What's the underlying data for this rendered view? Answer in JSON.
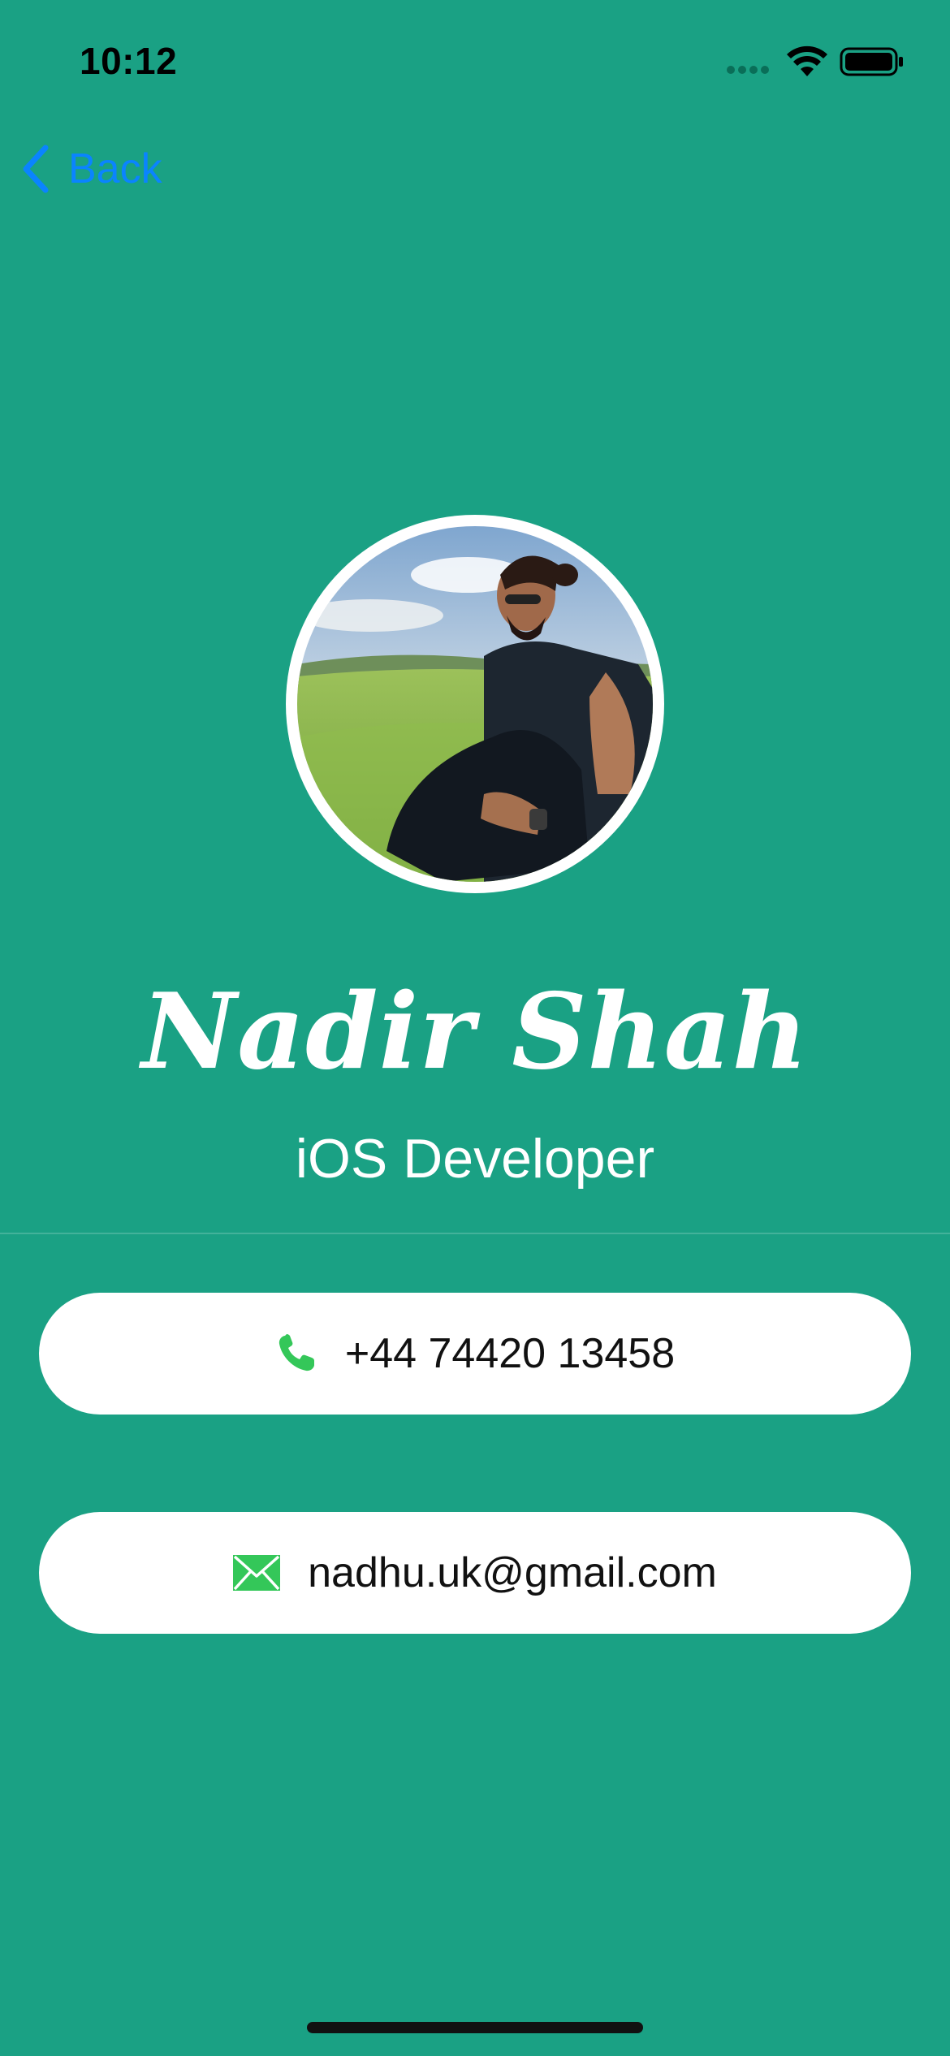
{
  "status_bar": {
    "time": "10:12",
    "icons": [
      "signal-icon",
      "wifi-icon",
      "battery-icon"
    ]
  },
  "nav": {
    "back_label": "Back",
    "back_icon": "chevron-left-icon"
  },
  "profile": {
    "name": "Nadir Shah",
    "title": "iOS Developer",
    "avatar_icon": "profile-photo"
  },
  "contacts": {
    "phone": "+44 74420 13458",
    "phone_icon": "phone-icon",
    "email": "nadhu.uk@gmail.com",
    "email_icon": "envelope-icon"
  },
  "colors": {
    "background": "#1aa184",
    "accent": "#0a84ff",
    "icon_green": "#34c759",
    "card": "#ffffff"
  }
}
